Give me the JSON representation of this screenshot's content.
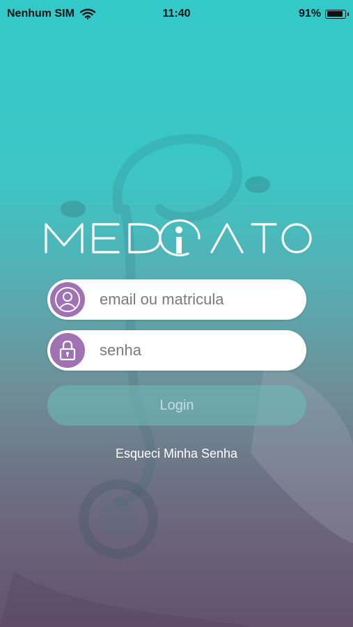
{
  "status_bar": {
    "carrier": "Nenhum SIM",
    "time": "11:40",
    "battery": "91%",
    "battery_level": 0.91
  },
  "logo": {
    "text": "MEDiATO",
    "icons": [
      "wordmark-logo"
    ]
  },
  "form": {
    "email": {
      "placeholder": "email ou matricula",
      "value": "",
      "icon": "user-icon"
    },
    "password": {
      "placeholder": "senha",
      "value": "",
      "icon": "lock-icon"
    },
    "login_label": "Login",
    "forgot_label": "Esqueci Minha Senha"
  },
  "colors": {
    "accent": "#a071b3",
    "top_gradient": "#34c9c9",
    "bottom_gradient": "#63516c"
  }
}
